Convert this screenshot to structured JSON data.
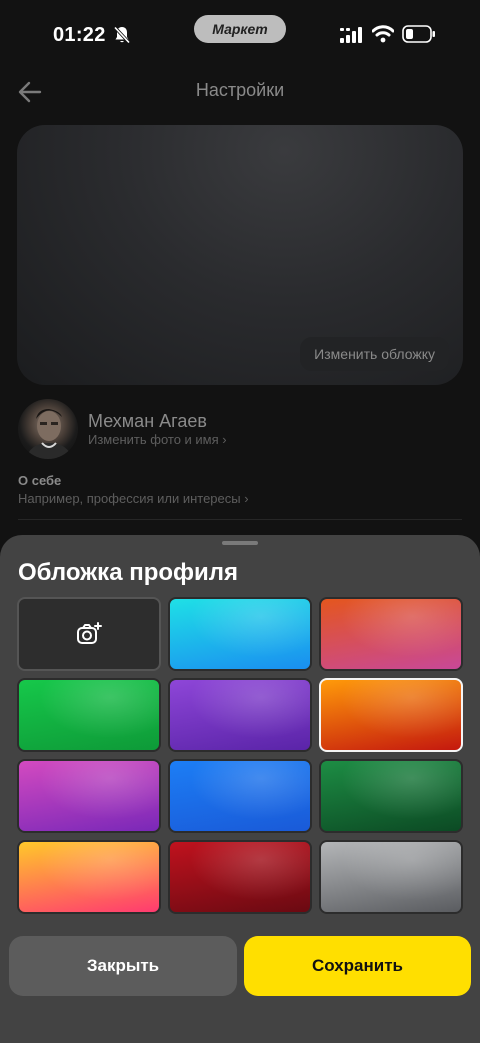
{
  "status_bar": {
    "time": "01:22",
    "market_label": "Маркет"
  },
  "header": {
    "title": "Настройки"
  },
  "cover": {
    "change_label": "Изменить обложку"
  },
  "profile": {
    "name": "Мехман Агаев",
    "edit_label": "Изменить фото и имя ›",
    "about_title": "О себе",
    "about_hint": "Например, профессия или интересы ›"
  },
  "sheet": {
    "title": "Обложка профиля",
    "upload_icon": "camera-plus-icon",
    "covers": [
      {
        "name": "cyan-blue",
        "colors": [
          "#1fe0e6",
          "#1a8ef0"
        ],
        "selected": false
      },
      {
        "name": "orange-pink",
        "colors": [
          "#e4561e",
          "#c84898"
        ],
        "selected": false
      },
      {
        "name": "green",
        "colors": [
          "#16c84a",
          "#0e9a38"
        ],
        "selected": false
      },
      {
        "name": "violet",
        "colors": [
          "#8e46d8",
          "#5a24a8"
        ],
        "selected": false
      },
      {
        "name": "orange-red",
        "colors": [
          "#ff9a0a",
          "#c4180e"
        ],
        "selected": true
      },
      {
        "name": "magenta-purple",
        "colors": [
          "#d34ac0",
          "#7a28b8"
        ],
        "selected": false
      },
      {
        "name": "blue",
        "colors": [
          "#1c7ef5",
          "#1a5ad8"
        ],
        "selected": false
      },
      {
        "name": "dark-green",
        "colors": [
          "#1d8d44",
          "#0c4a24"
        ],
        "selected": false
      },
      {
        "name": "yellow-pink",
        "colors": [
          "#ffc82a",
          "#ff3a70"
        ],
        "selected": false
      },
      {
        "name": "dark-red",
        "colors": [
          "#c0121e",
          "#6a0a12"
        ],
        "selected": false
      },
      {
        "name": "grey",
        "colors": [
          "#b4b6b8",
          "#5a5c60"
        ],
        "selected": false
      }
    ],
    "close_label": "Закрыть",
    "save_label": "Сохранить"
  },
  "colors": {
    "accent_yellow": "#ffdf00",
    "sheet_bg": "#434343",
    "page_bg": "#121212"
  }
}
